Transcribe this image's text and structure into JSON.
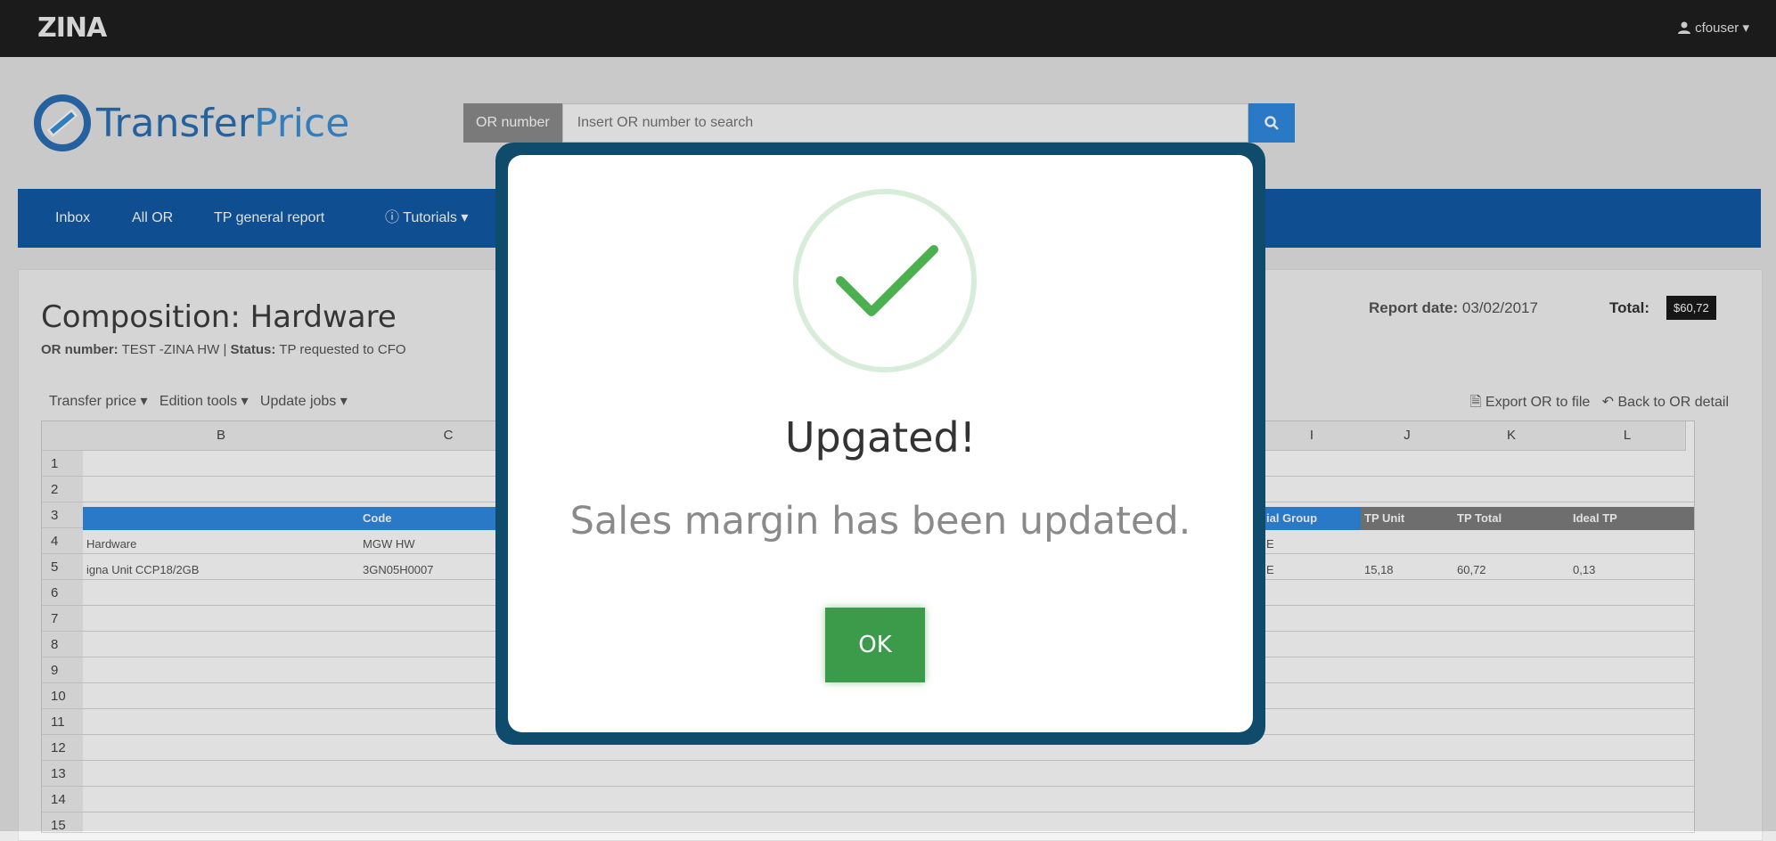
{
  "topbar": {
    "brand": "ZINA",
    "user": "cfouser ▾"
  },
  "header": {
    "logo_main": "Transfer",
    "logo_accent": "Price",
    "search_prefix": "OR number",
    "search_placeholder": "Insert OR number to search"
  },
  "nav": {
    "inbox": "Inbox",
    "all_or": "All OR",
    "report": "TP general report",
    "tutorials": "ⓘ Tutorials ▾"
  },
  "composition": {
    "title": "Composition: Hardware",
    "or_label": "OR number:",
    "or_value": "TEST -ZINA HW |",
    "status_label": "Status:",
    "status_value": "TP requested to CFO",
    "report_label": "Report date:",
    "report_value": "03/02/2017",
    "total_label": "Total:",
    "total_value": "$60,72"
  },
  "toolbar": {
    "transfer_price": "Transfer price ▾",
    "edition_tools": "Edition tools ▾",
    "update_jobs": "Update jobs ▾",
    "export": "Export OR to file",
    "back": "Back to OR detail"
  },
  "grid": {
    "columns": [
      "B",
      "C",
      "I",
      "J",
      "K",
      "L"
    ],
    "rows": [
      "1",
      "2",
      "3",
      "4",
      "5",
      "6",
      "7",
      "8",
      "9",
      "10",
      "11",
      "12",
      "13",
      "14",
      "15"
    ],
    "header_row": {
      "code": "Code",
      "group": "ial Group",
      "tp_unit": "TP Unit",
      "tp_total": "TP Total",
      "ideal_tp": "Ideal TP"
    },
    "row4": {
      "b": "Hardware",
      "c": "MGW HW",
      "i": "E"
    },
    "row5": {
      "b": "igna Unit CCP18/2GB",
      "c": "3GN05H0007",
      "i": "E",
      "j": "15,18",
      "k": "60,72",
      "l": "0,13"
    }
  },
  "modal": {
    "title": "Upgated!",
    "message": "Sales margin has been updated.",
    "ok": "OK"
  },
  "colors": {
    "nav": "#1159a6",
    "success": "#3b9b4a",
    "frame": "#0f4c6c"
  }
}
